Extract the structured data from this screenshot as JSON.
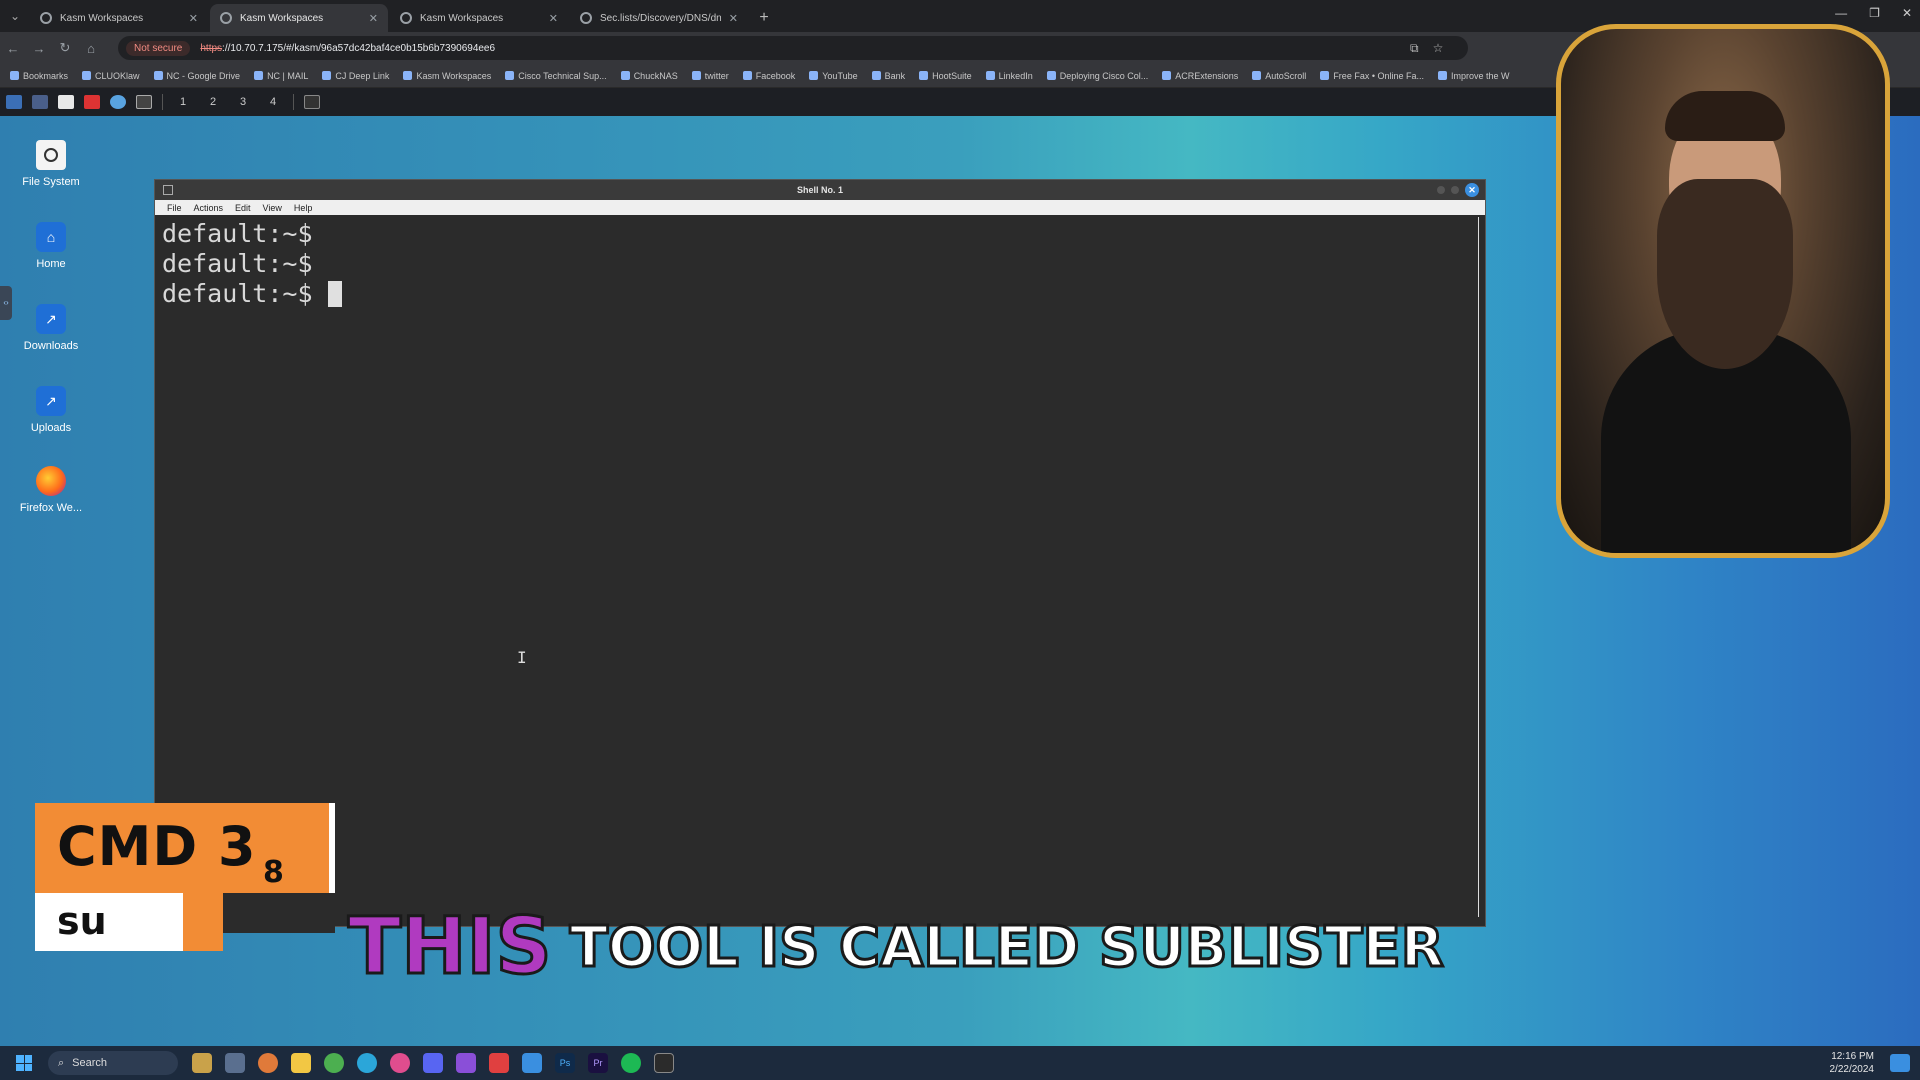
{
  "browser": {
    "tabs": [
      {
        "label": "Kasm Workspaces",
        "active": false
      },
      {
        "label": "Kasm Workspaces",
        "active": true
      },
      {
        "label": "Kasm Workspaces",
        "active": false
      },
      {
        "label": "Sec.lists/Discovery/DNS/dns-li",
        "active": false
      }
    ],
    "not_secure": "Not secure",
    "url_scheme": "https",
    "url_rest": "://10.70.7.175/#/kasm/96a57dc42baf4ce0b15b6b7390694ee6",
    "bookmarks": [
      "Bookmarks",
      "CLUOKlaw",
      "NC - Google Drive",
      "NC | MAIL",
      "CJ Deep Link",
      "Kasm Workspaces",
      "Cisco Technical Sup...",
      "ChuckNAS",
      "twitter",
      "Facebook",
      "YouTube",
      "Bank",
      "HootSuite",
      "LinkedIn",
      "Deploying Cisco Col...",
      "ACRExtensions",
      "AutoScroll",
      "Free Fax • Online Fa...",
      "Improve the W"
    ]
  },
  "panel": {
    "workspaces": [
      "1",
      "2",
      "3",
      "4"
    ]
  },
  "desktop": {
    "icons": [
      {
        "label": "File System"
      },
      {
        "label": "Home"
      },
      {
        "label": "Downloads"
      },
      {
        "label": "Uploads"
      },
      {
        "label": "Firefox We..."
      }
    ]
  },
  "terminal": {
    "title": "Shell No. 1",
    "menu": [
      "File",
      "Actions",
      "Edit",
      "View",
      "Help"
    ],
    "lines": [
      "default:~$",
      "default:~$",
      "default:~$"
    ]
  },
  "overlay": {
    "badge_cmd": "CMD 3",
    "badge_num": "8",
    "badge_sub": "su",
    "caption_highlight": "THIS",
    "caption_rest": "TOOL IS CALLED SUBLISTER"
  },
  "taskbar": {
    "search_placeholder": "Search",
    "time": "12:16 PM",
    "date": "2/22/2024"
  },
  "colors": {
    "accent_orange": "#f28c35",
    "caption_purple": "#b03ac0",
    "webcam_border": "#d9a43a"
  }
}
